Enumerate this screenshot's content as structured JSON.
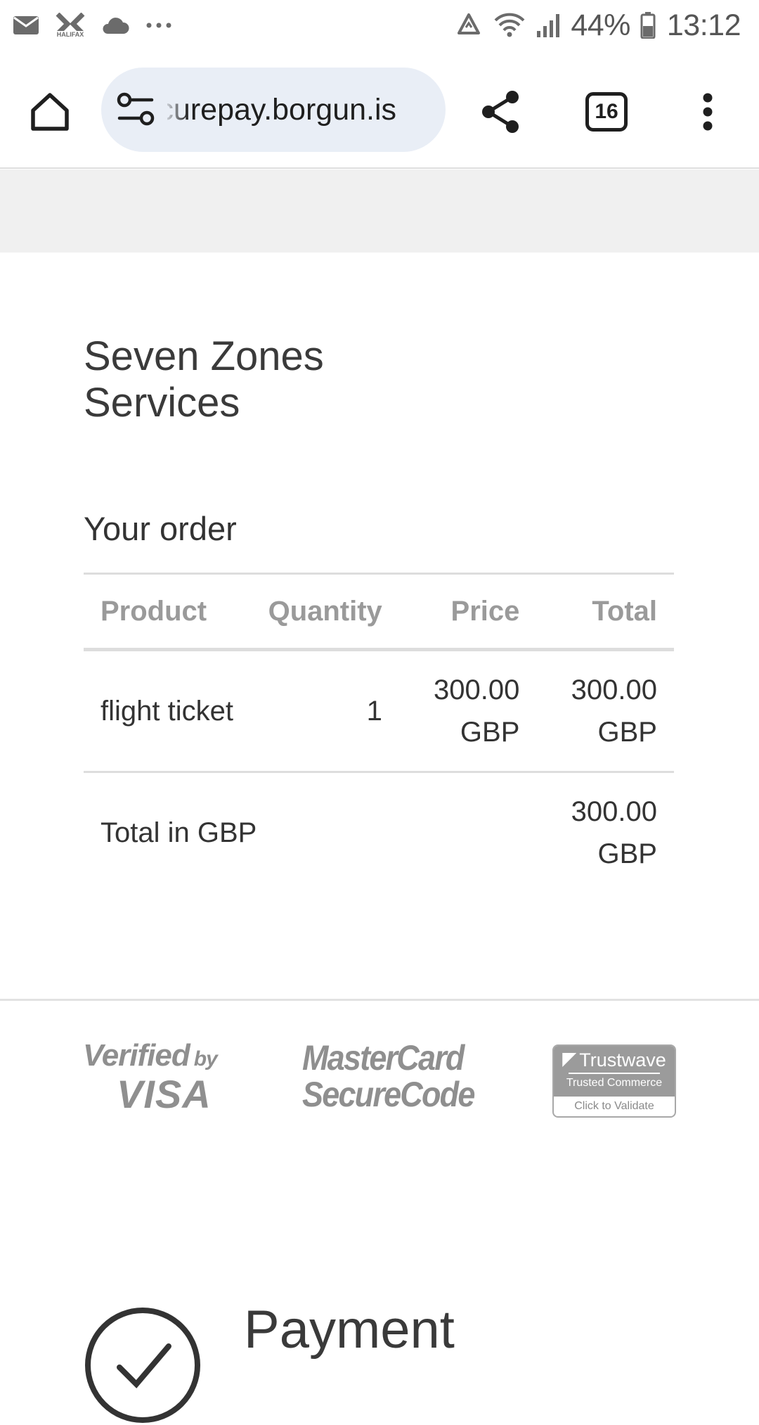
{
  "status_bar": {
    "battery_text": "44%",
    "time": "13:12",
    "left_icons": [
      "mail-icon",
      "halifax-icon",
      "cloud-icon",
      "more-notifications-icon"
    ],
    "right_icons": [
      "recycle-icon",
      "wifi-icon",
      "signal-icon",
      "battery-icon"
    ]
  },
  "browser": {
    "url": "securepay.borgun.is",
    "tab_count": "16",
    "icons": [
      "home-icon",
      "site-settings-icon",
      "share-icon",
      "tabs-icon",
      "more-vert-icon"
    ]
  },
  "page": {
    "merchant_name": "Seven Zones Services",
    "order_heading": "Your order",
    "table": {
      "headers": {
        "product": "Product",
        "quantity": "Quantity",
        "price": "Price",
        "total": "Total"
      },
      "rows": [
        {
          "product": "flight ticket",
          "quantity": "1",
          "price": "300.00 GBP",
          "total": "300.00 GBP"
        }
      ],
      "total_label": "Total in GBP",
      "total_value": "300.00 GBP"
    },
    "trust_logos": {
      "visa_line1": "Verified",
      "visa_by": "by",
      "visa_line2": "VISA",
      "mc_line1": "MasterCard",
      "mc_line2": "SecureCode",
      "trustwave_brand": "Trustwave",
      "trustwave_sub": "Trusted Commerce",
      "trustwave_click": "Click to Validate"
    },
    "payment_title": "Payment"
  },
  "colors": {
    "url_pill_bg": "#e9eef6",
    "grey_band": "#f0f0f0",
    "table_header_text": "#9a9a9a",
    "logo_grey": "#8f8f8f"
  }
}
